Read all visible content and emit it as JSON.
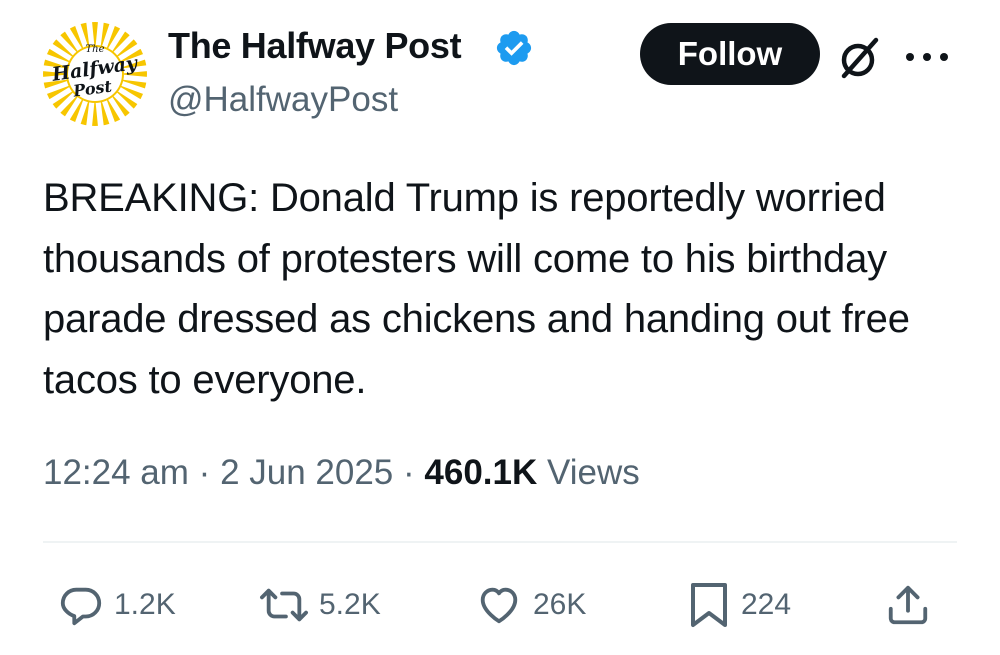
{
  "author": {
    "name": "The Halfway Post",
    "handle": "@HalfwayPost",
    "verified": true,
    "avatar_logo": {
      "line1": "The",
      "line2": "Halfway",
      "line3": "Post"
    }
  },
  "follow_button": {
    "label": "Follow"
  },
  "header_icons": [
    "grok-icon",
    "more-icon"
  ],
  "tweet": {
    "text": "BREAKING: Donald Trump is reportedly worried thousands of protesters will come to his birthday parade dressed as chickens and handing out free tacos to everyone.",
    "time": "12:24 am",
    "separator": "·",
    "date": "2 Jun 2025",
    "views_count": "460.1K",
    "views_label": "Views"
  },
  "actions": {
    "replies": "1.2K",
    "reposts": "5.2K",
    "likes": "26K",
    "bookmarks": "224"
  },
  "colors": {
    "text_primary": "#0f1419",
    "text_secondary": "#536471",
    "verified_blue": "#1d9bf0",
    "follow_bg": "#0f1419",
    "avatar_yellow": "#f7c600",
    "divider": "#eff3f4"
  }
}
